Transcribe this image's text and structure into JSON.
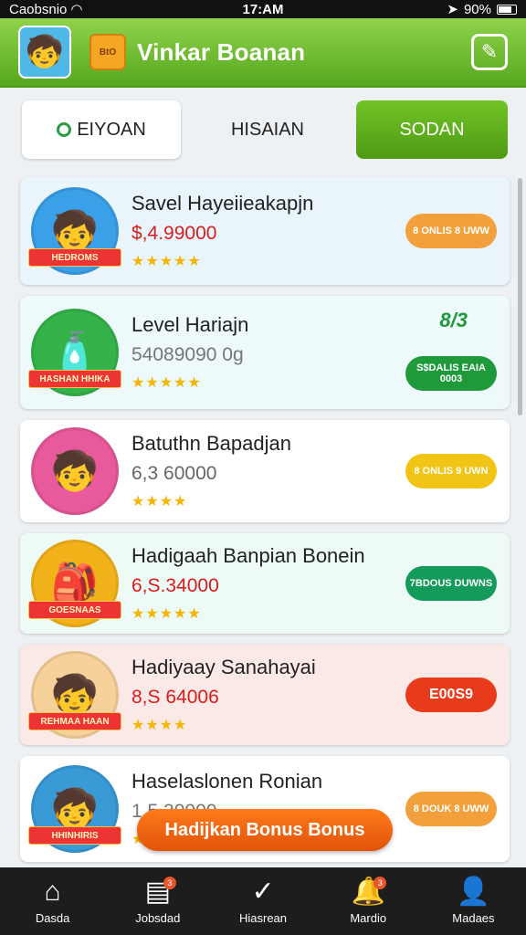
{
  "status": {
    "carrier": "Caobsnio",
    "time": "17:AM",
    "battery": "90%"
  },
  "header": {
    "title": "Vinkar Boanan",
    "wallet_label": "BtO"
  },
  "tabs": [
    "EIYOAN",
    "HISAIAN",
    "SODAN"
  ],
  "items": [
    {
      "name": "Savel Hayeiieakapjn",
      "price": "$,4.99000",
      "price_color": "#d81d1d",
      "stars": "★★★★★",
      "tag": "HEDROMS",
      "badge": "8 ONLIS 8 UWW",
      "badge_color": "#f2a03c",
      "thumb_bg": "#3aa0e8",
      "thumb_icon": "🧒"
    },
    {
      "name": "Level Hariajn",
      "price": "54089090 0g",
      "price_color": "#777777",
      "stars": "★★★★★",
      "tag": "HASHAN HHIKA",
      "badge": "S$DALIS EAIA 0003",
      "badge_color": "#1f9a3a",
      "thumb_bg": "#35b34a",
      "thumb_icon": "🧴",
      "extra": "8/3"
    },
    {
      "name": "Batuthn Bapadjan",
      "price": "6,3 60000",
      "price_color": "#666666",
      "stars": "★★★★",
      "badge": "8 ONLIS 9 UWN",
      "badge_color": "#f2c415",
      "thumb_bg": "#e85a9b",
      "thumb_icon": "🧒"
    },
    {
      "name": "Hadigaah Banpian Bonein",
      "price": "6,S.34000",
      "price_color": "#d81d1d",
      "stars": "★★★★★",
      "tag": "GOESNAAS",
      "badge": "7BDOUS DUWNS",
      "badge_color": "#149a5a",
      "thumb_bg": "#f2b21a",
      "thumb_icon": "🎒"
    },
    {
      "name": "Hadiyaay Sanahayai",
      "price": "8,S 64006",
      "price_color": "#d81d1d",
      "stars": "★★★★",
      "tag": "REHMAA HAAN",
      "badge": "E00S9",
      "badge_color": "#e83b1c",
      "thumb_bg": "#f6d19a",
      "thumb_icon": "🧒"
    },
    {
      "name": "Haselaslonen Ronian",
      "price": "1.5.30000",
      "price_color": "#777777",
      "stars": "★★★★",
      "tag": "HHINHIRIS",
      "badge": "8 DOUK 8 UWW",
      "badge_color": "#f2a03c",
      "thumb_bg": "#3a9ad6",
      "thumb_icon": "🧒"
    }
  ],
  "cta": "Hadijkan Bonus Bonus",
  "nav": [
    {
      "label": "Dasda",
      "icon": "home-icon"
    },
    {
      "label": "Jobsdad",
      "icon": "tasks-icon",
      "badge": "3"
    },
    {
      "label": "Hiasrean",
      "icon": "check-circle-icon"
    },
    {
      "label": "Mardio",
      "icon": "bell-icon",
      "badge": "3"
    },
    {
      "label": "Madaes",
      "icon": "user-icon"
    }
  ]
}
